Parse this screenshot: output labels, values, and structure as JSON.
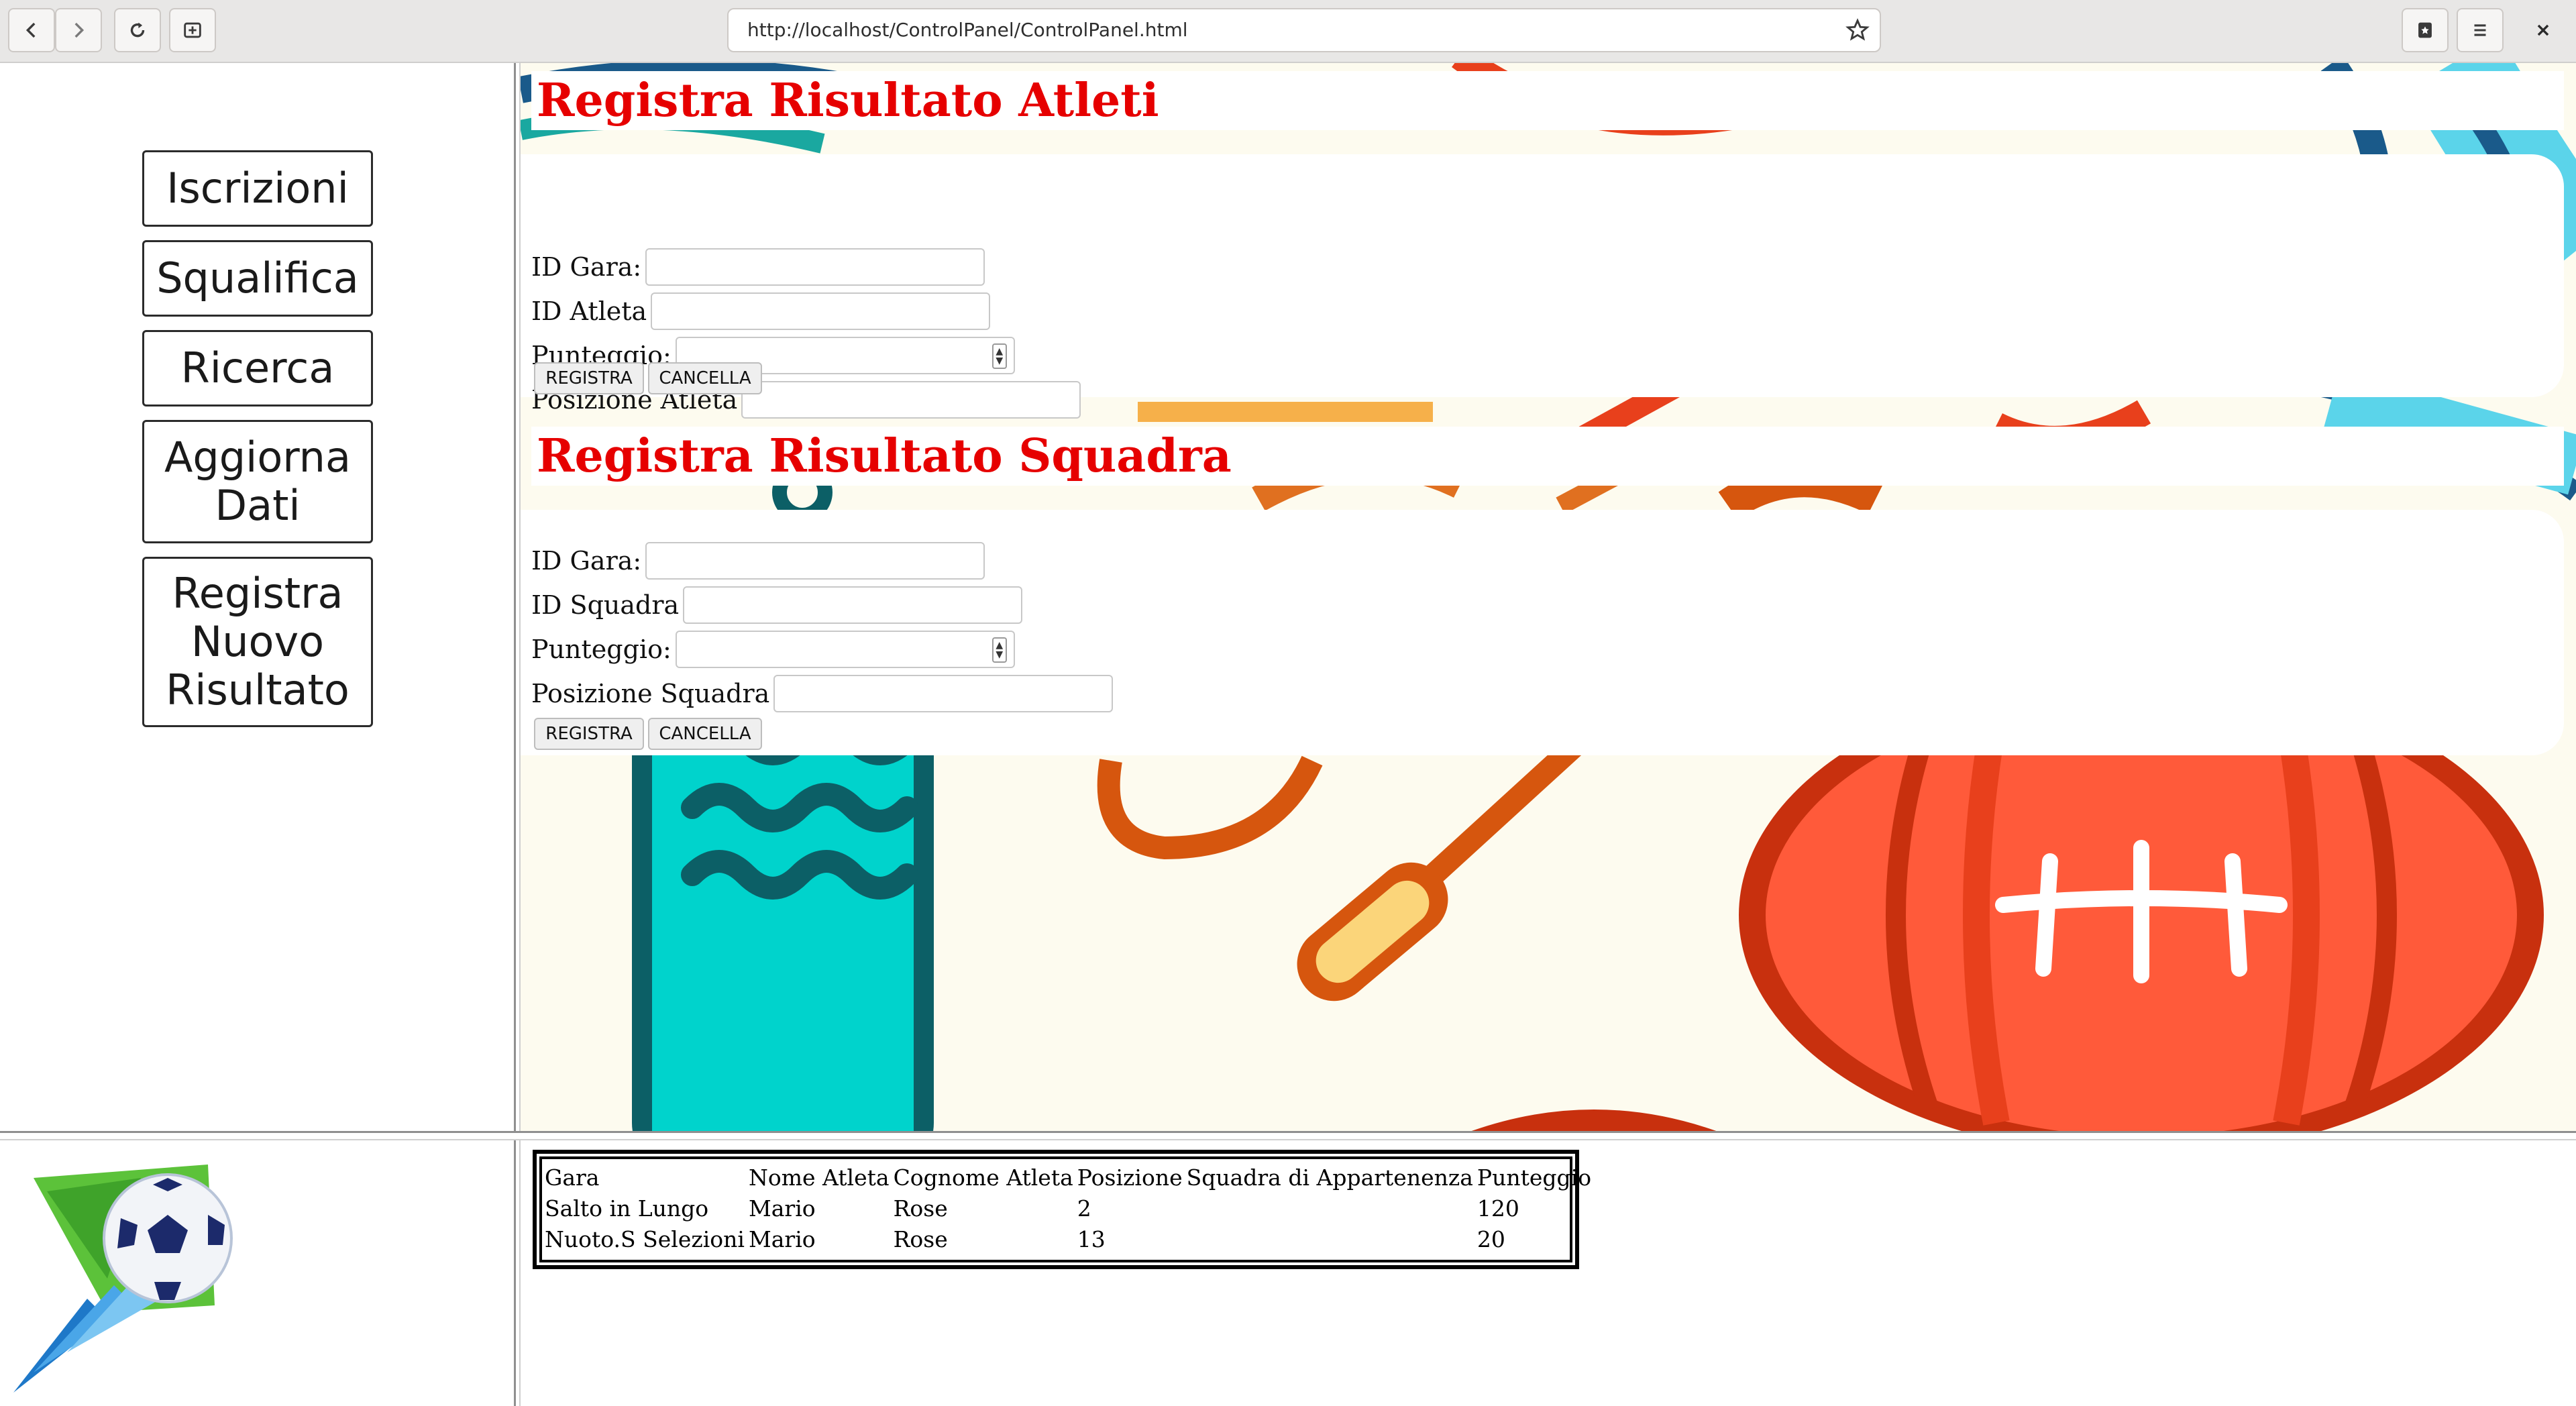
{
  "browser": {
    "url": "http://localhost/ControlPanel/ControlPanel.html"
  },
  "sidebar": {
    "items": [
      {
        "label": "Iscrizioni"
      },
      {
        "label": "Squalifica"
      },
      {
        "label": "Ricerca"
      },
      {
        "label": "Aggiorna Dati"
      },
      {
        "label": "Registra Nuovo Risultato"
      }
    ]
  },
  "athlete_form": {
    "title": "Registra Risultato Atleti",
    "id_gara_label": "ID Gara:",
    "id_atleta_label": "ID Atleta",
    "punteggio_label": "Punteggio:",
    "posizione_label": "Posizione Atleta",
    "register_label": "REGISTRA",
    "cancel_label": "CANCELLA"
  },
  "team_form": {
    "title": "Registra Risultato Squadra",
    "id_gara_label": "ID Gara:",
    "id_squadra_label": "ID Squadra",
    "punteggio_label": "Punteggio:",
    "posizione_label": "Posizione Squadra",
    "register_label": "REGISTRA",
    "cancel_label": "CANCELLA"
  },
  "results_table": {
    "headers": [
      "Gara",
      "Nome Atleta",
      "Cognome Atleta",
      "Posizione",
      "Squadra di Appartenenza",
      "Punteggio"
    ],
    "rows": [
      [
        "Salto in Lungo",
        "Mario",
        "Rose",
        "2",
        "",
        "120"
      ],
      [
        "Nuoto.S Selezioni",
        "Mario",
        "Rose",
        "13",
        "",
        "20"
      ]
    ]
  },
  "colors": {
    "title_red": "#e60000",
    "background_cream": "#fdfbef",
    "ball_red": "#e8401c",
    "bottle_teal": "#00d3cc",
    "accent_blue": "#5bd4ea"
  }
}
